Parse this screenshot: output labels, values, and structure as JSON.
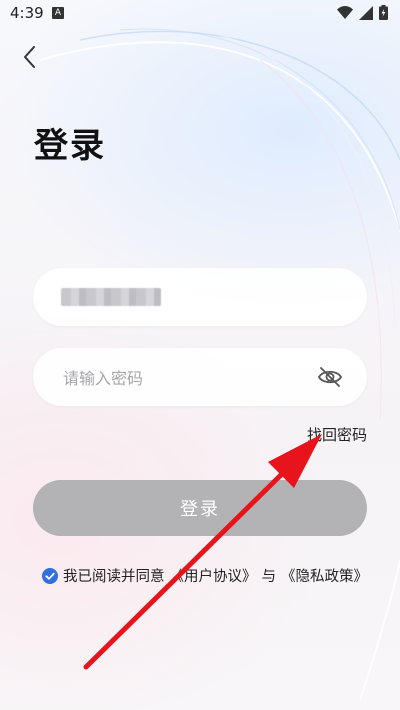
{
  "status_bar": {
    "time": "4:39",
    "notification_glyph": "A"
  },
  "header": {
    "back_icon": "chevron-left-icon",
    "title": "登录"
  },
  "form": {
    "account_value_masked": "",
    "password_placeholder": "请输入密码",
    "password_toggle_icon": "eye-off-icon",
    "forgot_password": "找回密码",
    "login_label": "登录"
  },
  "agreement": {
    "checked": true,
    "prefix": "我已阅读并同意",
    "user_agreement": "《用户协议》",
    "connector": "与",
    "privacy_policy": "《隐私政策》"
  },
  "colors": {
    "button_disabled": "#b3b3b6",
    "checkbox": "#2f6fe0",
    "annotation_arrow": "#e8141c"
  }
}
